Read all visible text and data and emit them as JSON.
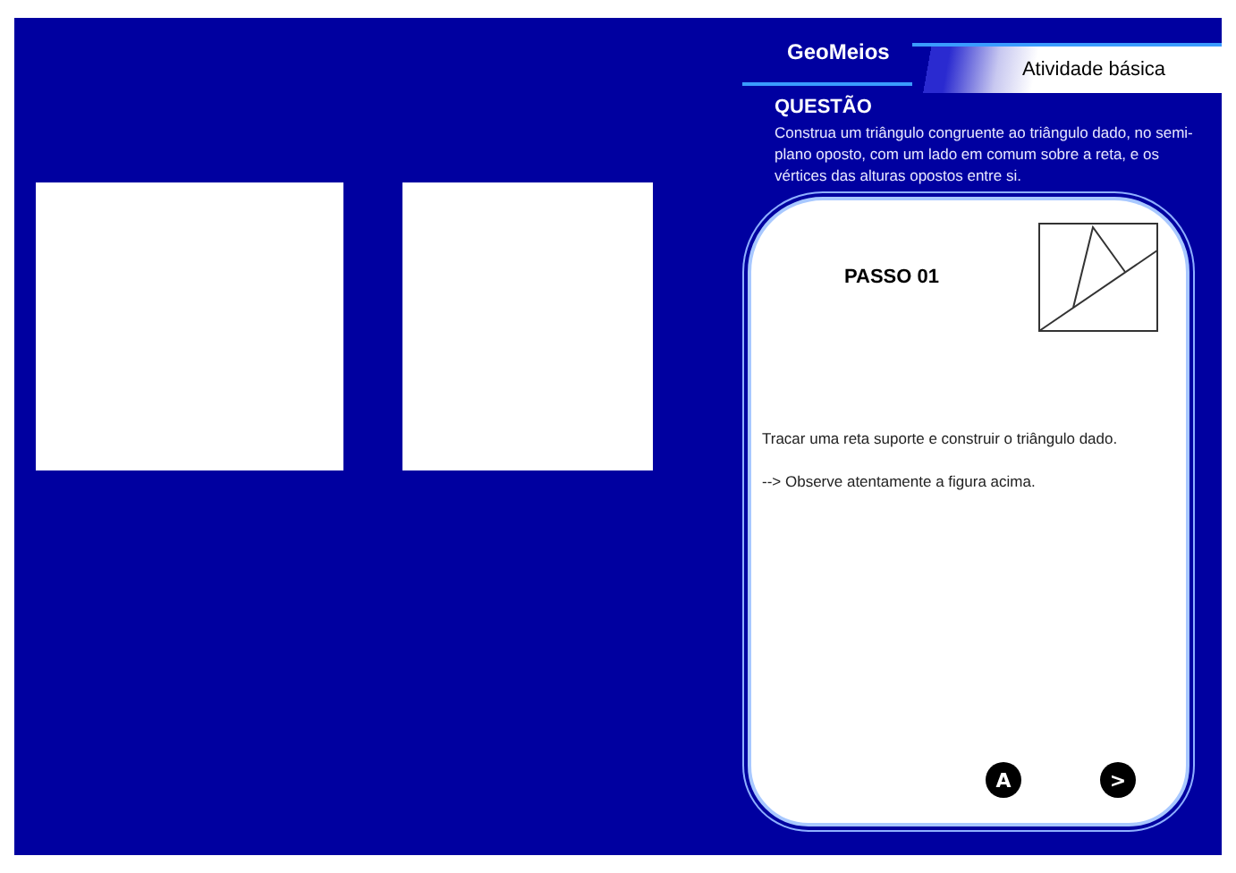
{
  "header": {
    "app_title": "GeoMeios",
    "activity": "Atividade básica"
  },
  "question": {
    "heading": "QUESTÃO",
    "text": "Construa um triângulo congruente ao triângulo dado, no semi-plano oposto, com um lado em comum sobre a reta, e os vértices das alturas opostos entre si."
  },
  "step": {
    "title": "PASSO 01",
    "instructions": [
      "Tracar uma reta suporte e construir o triângulo dado.",
      "--> Observe atentamente a figura acima."
    ],
    "buttons": [
      {
        "label": "A"
      },
      {
        "label": ">"
      }
    ]
  }
}
